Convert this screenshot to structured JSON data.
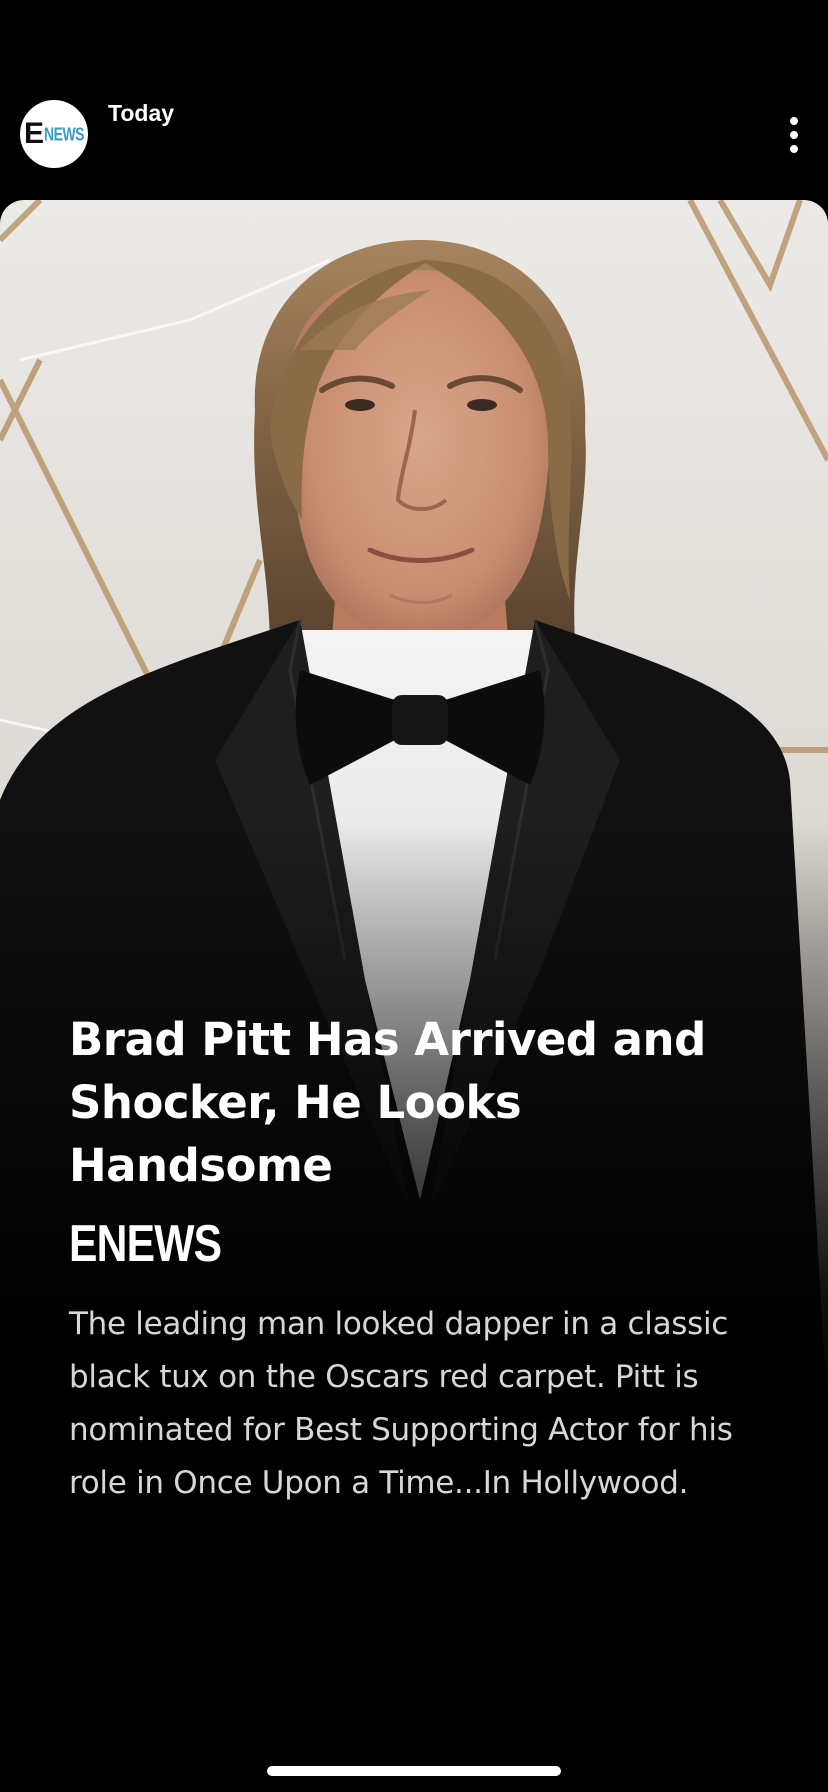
{
  "header": {
    "publisher_logo_letter": "E",
    "publisher_logo_suffix": "NEWS",
    "publish_time": "Today",
    "more_icon": "vertical-ellipsis-icon"
  },
  "story": {
    "image_alt": "Brad Pitt in a black tuxedo and bow tie on the red carpet",
    "headline": "Brad Pitt Has Arrived and Shocker, He Looks Handsome",
    "brand": "ENEWS",
    "summary": "The leading man looked dapper in a classic black tux on the Oscars red carpet. Pitt is nominated for Best Supporting Actor for his role in Once Upon a Time...In Hollywood."
  },
  "colors": {
    "background": "#000000",
    "brand_accent": "#3a9cc4",
    "summary_text": "#d7d7d7"
  }
}
